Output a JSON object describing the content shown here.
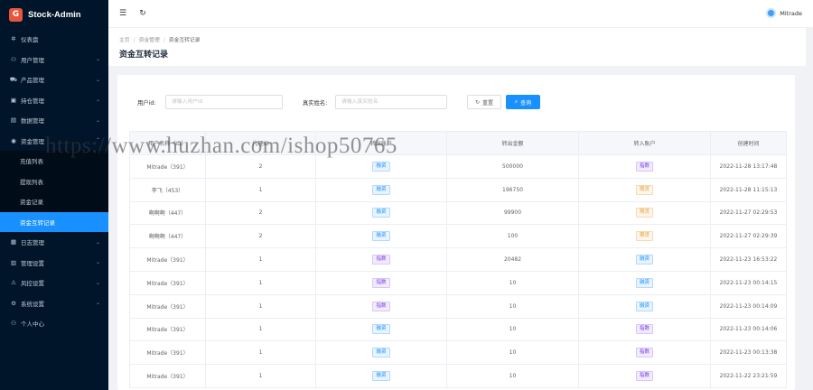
{
  "app": {
    "title": "Stock-Admin",
    "logo_glyph": "G"
  },
  "sidebar": {
    "items": [
      {
        "label": "仪表盘",
        "icon": "dashboard-icon",
        "glyph": "✲"
      },
      {
        "label": "用户管理",
        "icon": "user-icon",
        "glyph": "⚇"
      },
      {
        "label": "产品管理",
        "icon": "cart-icon",
        "glyph": "⛟"
      },
      {
        "label": "持仓管理",
        "icon": "holding-icon",
        "glyph": "▣"
      },
      {
        "label": "数据管理",
        "icon": "data-icon",
        "glyph": "▤"
      },
      {
        "label": "资金管理",
        "icon": "funds-icon",
        "glyph": "◉",
        "expanded": true
      }
    ],
    "sub_items": [
      {
        "label": "充值列表"
      },
      {
        "label": "提现列表"
      },
      {
        "label": "资金记录"
      },
      {
        "label": "资金互转记录",
        "active": true
      }
    ],
    "items_after": [
      {
        "label": "日志管理",
        "icon": "log-icon",
        "glyph": "▦"
      },
      {
        "label": "管理设置",
        "icon": "admin-icon",
        "glyph": "▥"
      },
      {
        "label": "风控设置",
        "icon": "risk-icon",
        "glyph": "⚠"
      },
      {
        "label": "系统设置",
        "icon": "settings-icon",
        "glyph": "⚙"
      },
      {
        "label": "个人中心",
        "icon": "profile-icon",
        "glyph": "⚇"
      }
    ]
  },
  "header": {
    "username": "Mitrade"
  },
  "breadcrumb": {
    "home": "主页",
    "section": "资金管理",
    "current": "资金互转记录"
  },
  "page": {
    "title": "资金互转记录"
  },
  "filters": {
    "user_id_label": "用户id:",
    "user_id_placeholder": "请输入用户id",
    "name_label": "真实姓名:",
    "name_placeholder": "请输入真实姓名",
    "reset_label": "重置",
    "query_label": "查询"
  },
  "table": {
    "columns": [
      "用户名称（ID）",
      "代理ID",
      "转出账户",
      "转出金额",
      "转入账户",
      "创建时间"
    ],
    "rows": [
      {
        "user": "Mitrade（391）",
        "agent": "2",
        "from": "融资",
        "from_color": "blue",
        "amount": "500000",
        "to": "指数",
        "to_color": "purple",
        "time": "2022-11-28 13:17:48"
      },
      {
        "user": "李飞（453）",
        "agent": "1",
        "from": "融资",
        "from_color": "blue",
        "amount": "196750",
        "to": "期货",
        "to_color": "orange",
        "time": "2022-11-28 11:15:13"
      },
      {
        "user": "啊啊啊（447）",
        "agent": "2",
        "from": "融资",
        "from_color": "blue",
        "amount": "99900",
        "to": "期货",
        "to_color": "orange",
        "time": "2022-11-27 02:29:53"
      },
      {
        "user": "啊啊啊（447）",
        "agent": "2",
        "from": "融资",
        "from_color": "blue",
        "amount": "100",
        "to": "期货",
        "to_color": "orange",
        "time": "2022-11-27 02:29:39"
      },
      {
        "user": "Mitrade（391）",
        "agent": "1",
        "from": "指数",
        "from_color": "purple",
        "amount": "20482",
        "to": "融资",
        "to_color": "blue",
        "time": "2022-11-23 16:53:22"
      },
      {
        "user": "Mitrade（391）",
        "agent": "1",
        "from": "指数",
        "from_color": "purple",
        "amount": "10",
        "to": "融资",
        "to_color": "blue",
        "time": "2022-11-23 00:14:15"
      },
      {
        "user": "Mitrade（391）",
        "agent": "1",
        "from": "指数",
        "from_color": "purple",
        "amount": "10",
        "to": "融资",
        "to_color": "blue",
        "time": "2022-11-23 00:14:09"
      },
      {
        "user": "Mitrade（391）",
        "agent": "1",
        "from": "融资",
        "from_color": "blue",
        "amount": "10",
        "to": "指数",
        "to_color": "purple",
        "time": "2022-11-23 00:14:06"
      },
      {
        "user": "Mitrade（391）",
        "agent": "1",
        "from": "融资",
        "from_color": "blue",
        "amount": "10",
        "to": "指数",
        "to_color": "purple",
        "time": "2022-11-23 00:13:38"
      },
      {
        "user": "Mitrade（391）",
        "agent": "1",
        "from": "融资",
        "from_color": "blue",
        "amount": "10",
        "to": "指数",
        "to_color": "purple",
        "time": "2022-11-22 23:21:59"
      }
    ]
  },
  "watermark": "https://www.huzhan.com/ishop50765",
  "colors": {
    "sidebar_bg": "#001529",
    "active": "#1890ff",
    "page_bg": "#f0f2f5"
  }
}
